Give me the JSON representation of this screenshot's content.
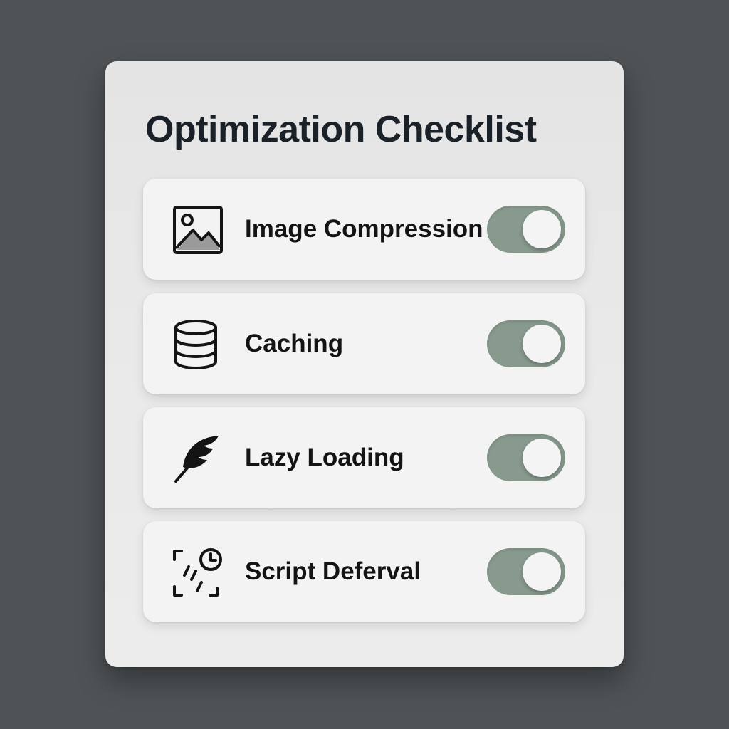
{
  "checklist": {
    "title": "Optimization Checklist",
    "toggle_on_color": "#889a8e",
    "items": [
      {
        "label": "Image Compression",
        "icon": "image-icon",
        "enabled": true
      },
      {
        "label": "Caching",
        "icon": "database-icon",
        "enabled": true
      },
      {
        "label": "Lazy Loading",
        "icon": "feather-icon",
        "enabled": true
      },
      {
        "label": "Script Deferval",
        "icon": "script-clock-icon",
        "enabled": true
      }
    ]
  }
}
